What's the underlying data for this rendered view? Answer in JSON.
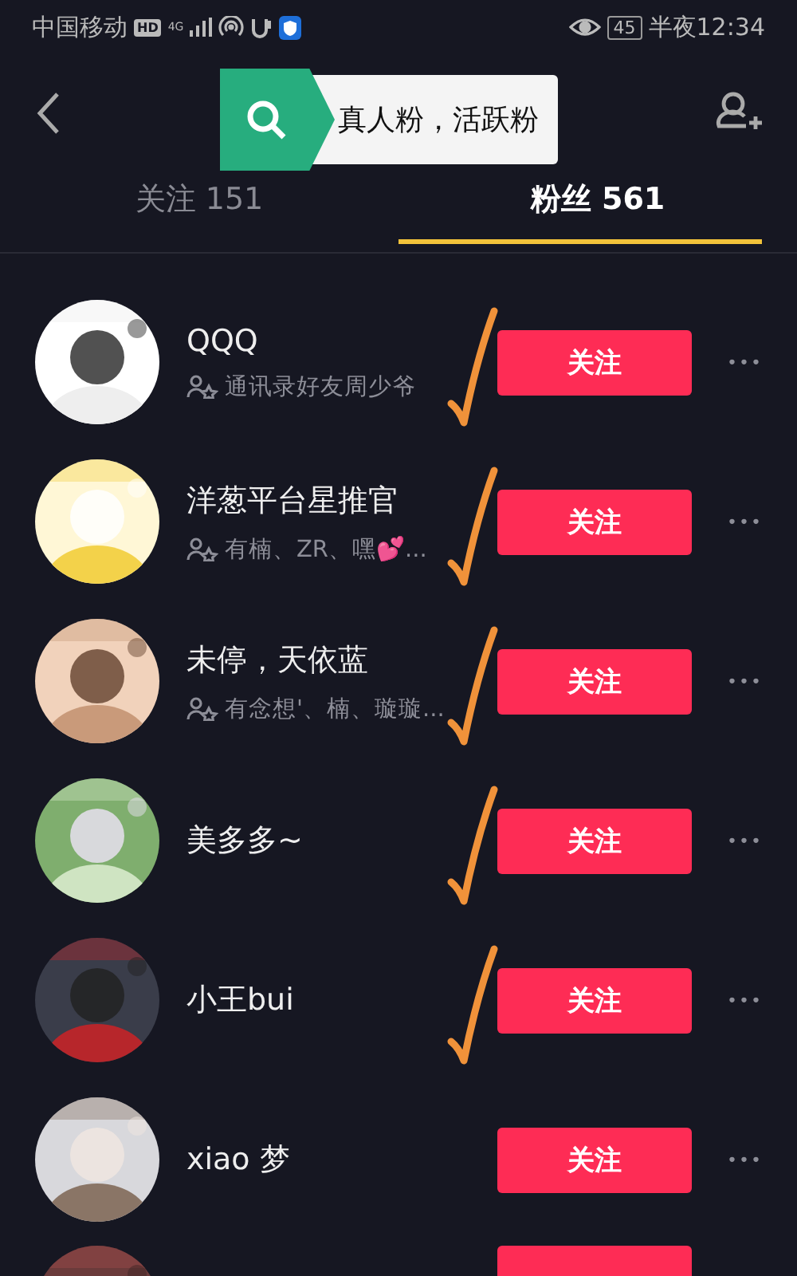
{
  "status_bar": {
    "carrier": "中国移动",
    "hd_badge": "HD",
    "network": "4G",
    "battery": "45",
    "time": "半夜12:34"
  },
  "banner": {
    "text": "真人粉，活跃粉"
  },
  "tabs": [
    {
      "label": "关注 151",
      "selected": false
    },
    {
      "label": "粉丝 561",
      "selected": true
    }
  ],
  "rows": [
    {
      "kind": "full",
      "name": "QQQ",
      "subtitle": "通讯录好友周少爷",
      "button": "关注",
      "more": "•••",
      "checked": true
    },
    {
      "kind": "full",
      "name": "洋葱平台星推官",
      "subtitle": "有楠、ZR、嘿💕...",
      "button": "关注",
      "more": "•••",
      "checked": true
    },
    {
      "kind": "full",
      "name": "未停，天依蓝",
      "subtitle": "有念想'、楠、璇璇...",
      "button": "关注",
      "more": "•••",
      "checked": true
    },
    {
      "kind": "full",
      "name": "美多多~",
      "button": "关注",
      "more": "•••",
      "checked": true
    },
    {
      "kind": "full",
      "name": "小王bui",
      "button": "关注",
      "more": "•••",
      "checked": true
    },
    {
      "kind": "full",
      "name": "xiao  梦",
      "button": "关注",
      "more": "•••",
      "checked": false
    },
    {
      "kind": "cut",
      "checked": false
    }
  ]
}
